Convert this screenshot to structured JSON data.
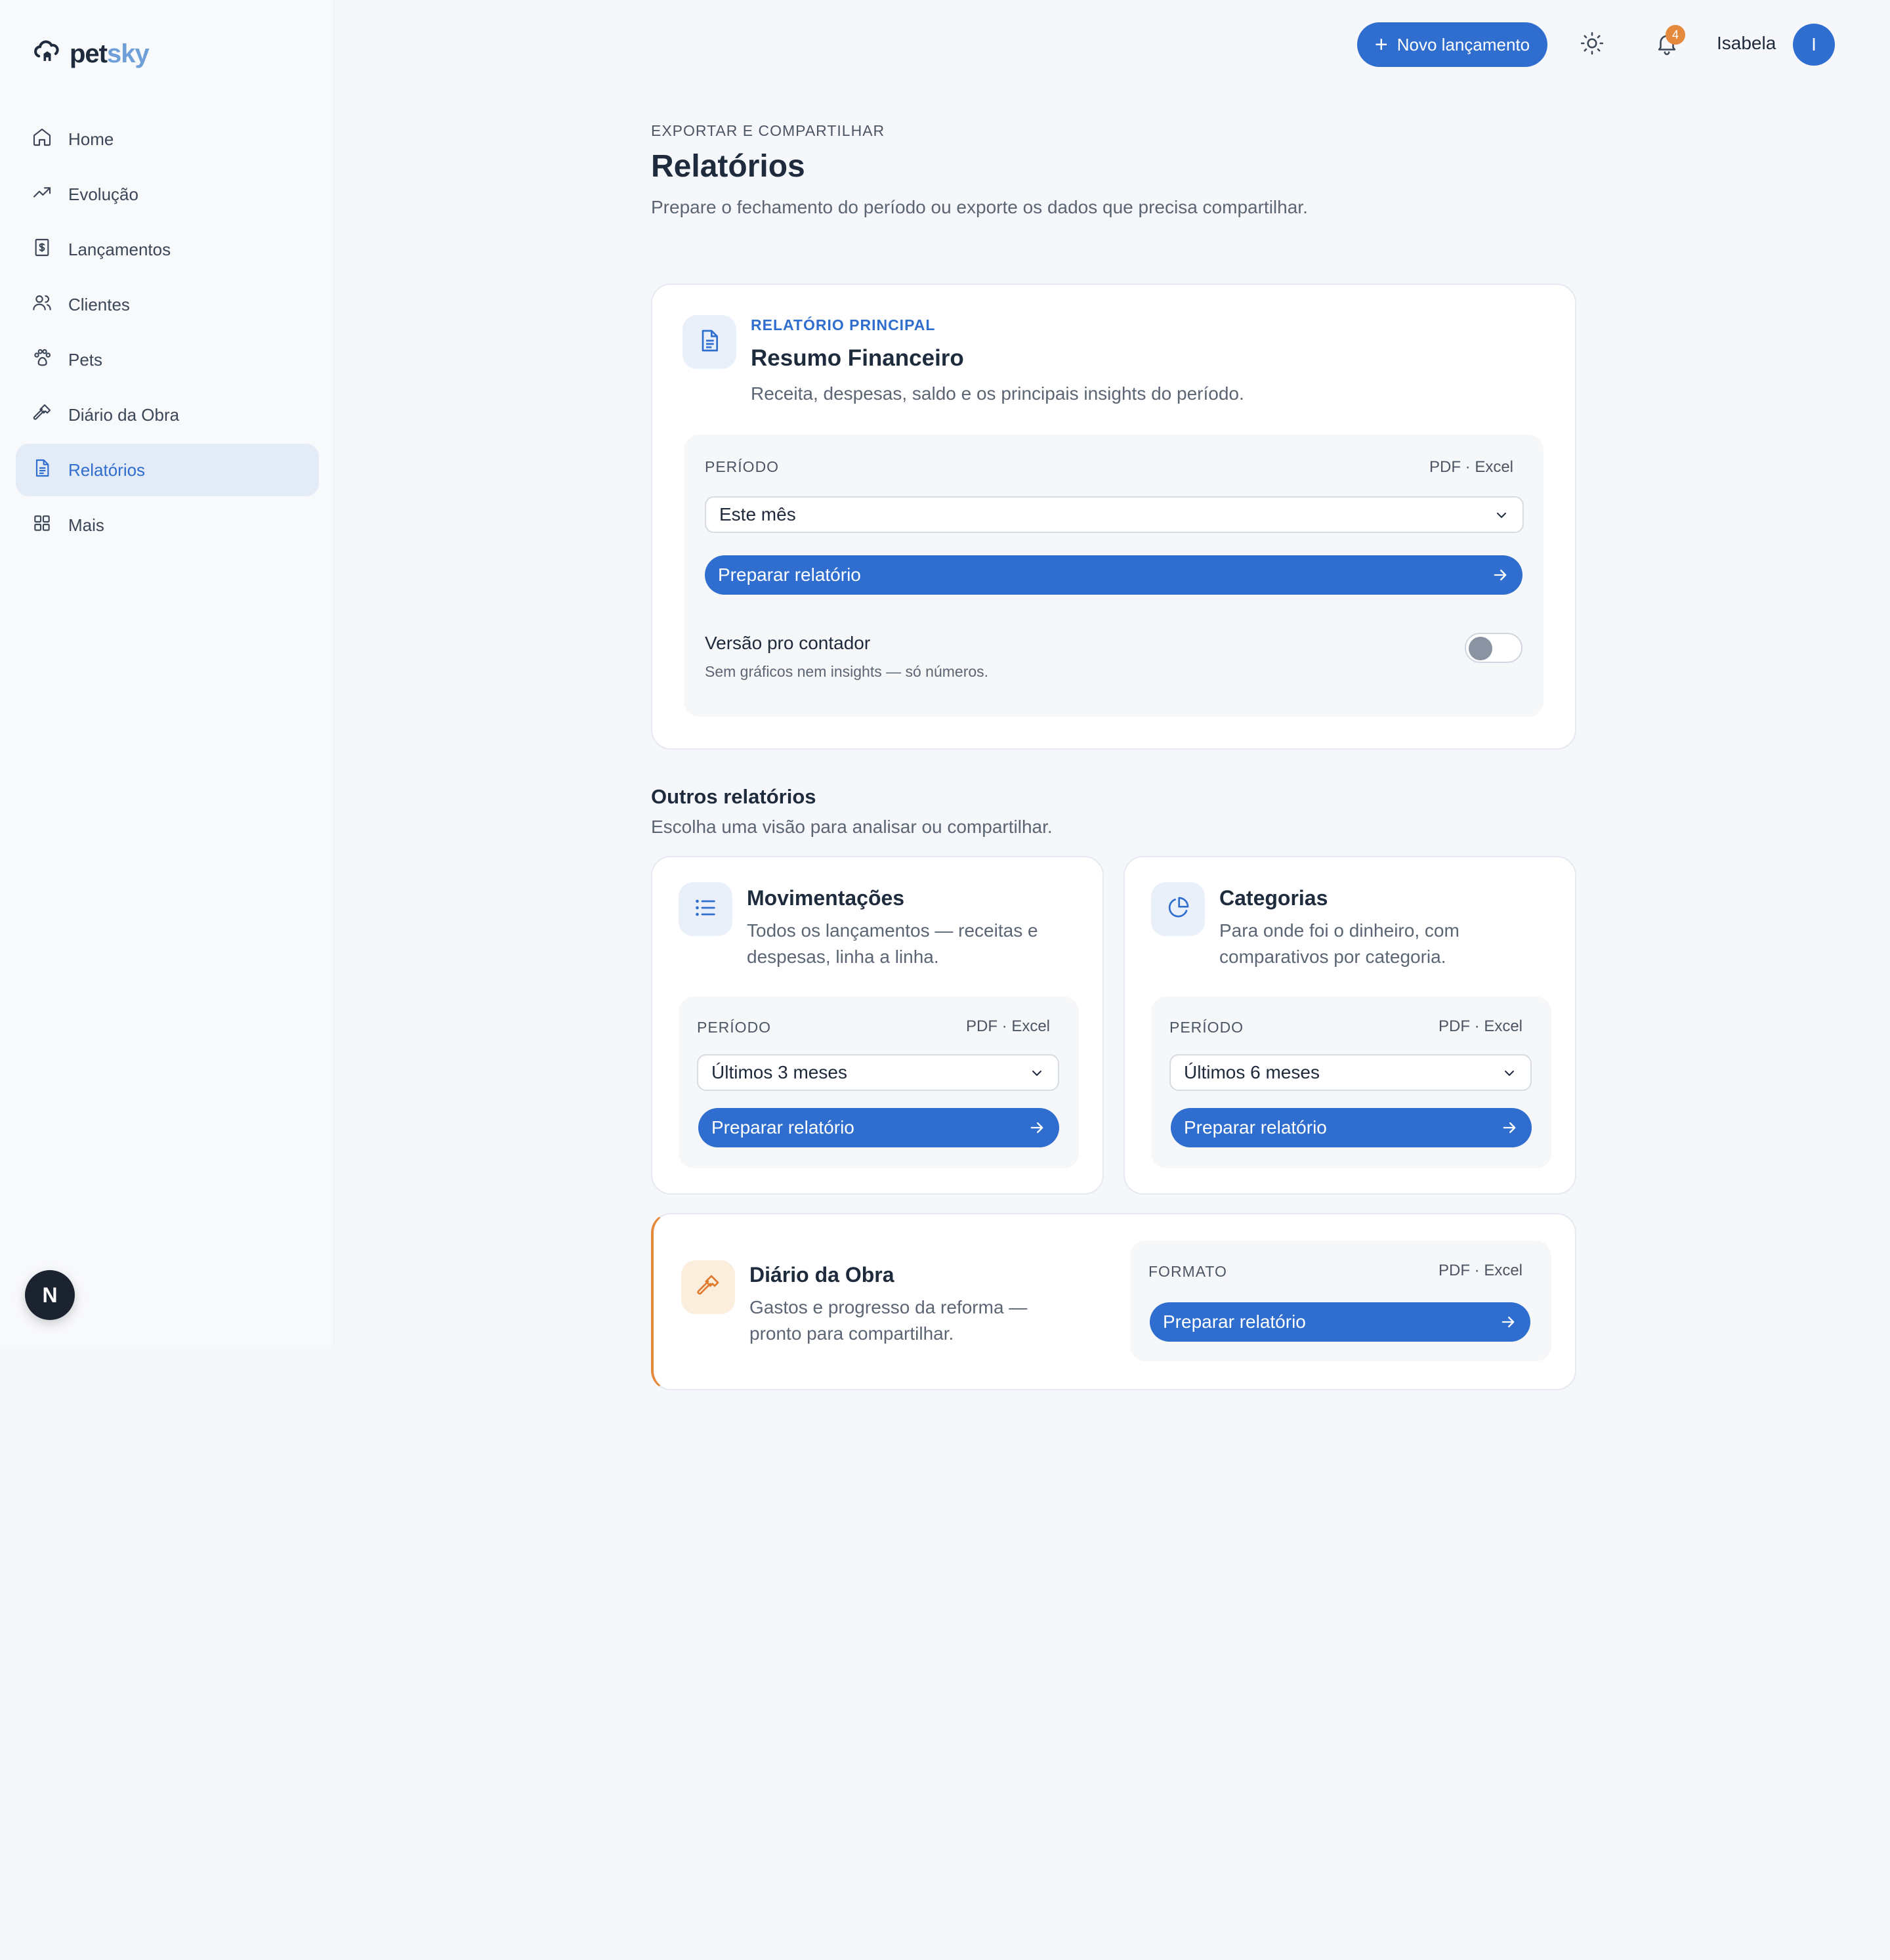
{
  "brand": {
    "name_part1": "pet",
    "name_part2": "sky"
  },
  "sidebar": {
    "items": [
      {
        "label": "Home",
        "icon": "home-icon"
      },
      {
        "label": "Evolução",
        "icon": "trending-up-icon"
      },
      {
        "label": "Lançamentos",
        "icon": "receipt-icon"
      },
      {
        "label": "Clientes",
        "icon": "users-icon"
      },
      {
        "label": "Pets",
        "icon": "paw-icon"
      },
      {
        "label": "Diário da Obra",
        "icon": "hammer-icon"
      },
      {
        "label": "Relatórios",
        "icon": "file-icon",
        "active": true
      },
      {
        "label": "Mais",
        "icon": "grid-icon"
      }
    ],
    "dev_badge": "N"
  },
  "topbar": {
    "new_button": "Novo lançamento",
    "notification_count": "4",
    "user_name": "Isabela",
    "user_initial": "I"
  },
  "header": {
    "eyebrow": "EXPORTAR E COMPARTILHAR",
    "title": "Relatórios",
    "subtitle": "Prepare o fechamento do período ou exporte os dados que precisa compartilhar."
  },
  "main_report": {
    "eyebrow": "RELATÓRIO PRINCIPAL",
    "title": "Resumo Financeiro",
    "description": "Receita, despesas, saldo e os principais insights do período.",
    "period_label": "PERÍODO",
    "formats": "PDF · Excel",
    "period_value": "Este mês",
    "cta": "Preparar relatório",
    "toggle_title": "Versão pro contador",
    "toggle_desc": "Sem gráficos nem insights — só números.",
    "toggle_on": false
  },
  "others": {
    "title": "Outros relatórios",
    "subtitle": "Escolha uma visão para analisar ou compartilhar.",
    "cards": [
      {
        "title": "Movimentações",
        "description_line1": "Todos os lançamentos — receitas e",
        "description_line2": "despesas, linha a linha.",
        "period_label": "PERÍODO",
        "formats": "PDF · Excel",
        "period_value": "Últimos 3 meses",
        "cta": "Preparar relatório"
      },
      {
        "title": "Categorias",
        "description_line1": "Para onde foi o dinheiro, com",
        "description_line2": "comparativos por categoria.",
        "period_label": "PERÍODO",
        "formats": "PDF · Excel",
        "period_value": "Últimos 6 meses",
        "cta": "Preparar relatório"
      }
    ]
  },
  "obra_report": {
    "title": "Diário da Obra",
    "description_line1": "Gastos e progresso da reforma —",
    "description_line2": "pronto para compartilhar.",
    "format_label": "FORMATO",
    "formats": "PDF · Excel",
    "cta": "Preparar relatório"
  },
  "colors": {
    "accent": "#2f6ecf",
    "accent_soft": "#e3ebf7",
    "warning": "#e58a3c",
    "background": "#f6f7fa"
  }
}
